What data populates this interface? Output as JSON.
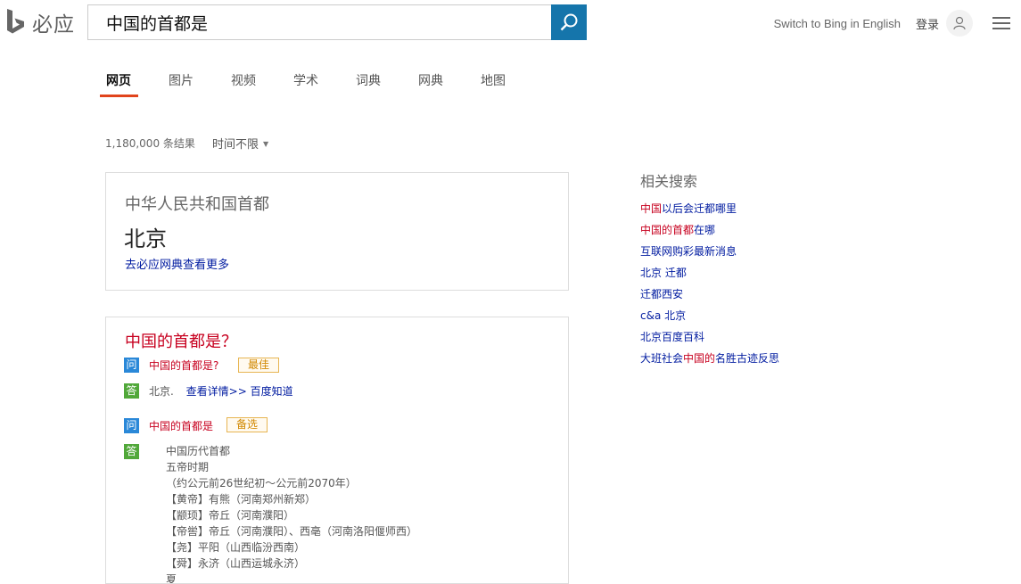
{
  "header": {
    "logo_text": "必应",
    "search_query": "中国的首都是",
    "switch_english": "Switch to Bing in English",
    "login": "登录"
  },
  "tabs": [
    "网页",
    "图片",
    "视频",
    "学术",
    "词典",
    "网典",
    "地图"
  ],
  "results": {
    "count": "1,180,000 条结果",
    "time_filter": "时间不限"
  },
  "answer_card": {
    "subtitle": "中华人民共和国首都",
    "answer": "北京",
    "more_link": "去必应网典查看更多"
  },
  "qa_card": {
    "title": "中国的首都是？",
    "q_badge": "问",
    "a_badge": "答",
    "item1": {
      "question": "中国的首都是?",
      "tag": "最佳",
      "answer_text": "北京.",
      "detail_link": "查看详情>>",
      "source": "百度知道"
    },
    "item2": {
      "question": "中国的首都是",
      "tag": "备选",
      "lines": [
        "中国历代首都",
        "五帝时期",
        "（约公元前26世纪初～公元前2070年）",
        "【黄帝】有熊（河南郑州新郑）",
        "【颛顼】帝丘（河南濮阳）",
        "【帝喾】帝丘（河南濮阳）、西亳（河南洛阳偃师西）",
        "【尧】平阳（山西临汾西南）",
        "【舜】永济（山西运城永济）",
        "夏"
      ]
    }
  },
  "related": {
    "title": "相关搜索",
    "items": [
      {
        "pre": "",
        "hl": "中国",
        "post": "以后会迁都哪里"
      },
      {
        "pre": "",
        "hl": "中国的首都",
        "post": "在哪"
      },
      {
        "pre": "互联网购彩最新消息",
        "hl": "",
        "post": ""
      },
      {
        "pre": "北京 迁都",
        "hl": "",
        "post": ""
      },
      {
        "pre": "迁都西安",
        "hl": "",
        "post": ""
      },
      {
        "pre": "c&a 北京",
        "hl": "",
        "post": ""
      },
      {
        "pre": "北京百度百科",
        "hl": "",
        "post": ""
      },
      {
        "pre": "大班社会",
        "hl": "中国的",
        "post": "名胜古迹反思"
      }
    ]
  },
  "colors": {
    "accent_blue": "#1575ab",
    "link": "#001ba0",
    "highlight_red": "#c7001f",
    "tab_underline": "#e1441c"
  },
  "icons": {
    "search": "search-icon",
    "avatar": "user-icon",
    "menu": "hamburger-menu-icon"
  }
}
